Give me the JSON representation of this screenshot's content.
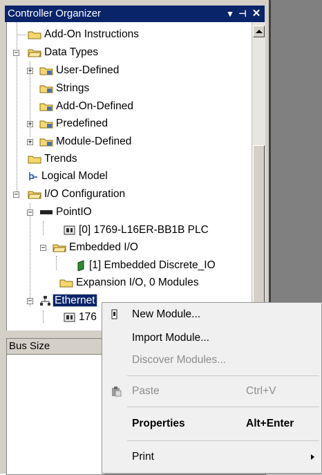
{
  "panel": {
    "title": "Controller Organizer",
    "pin_icon": "pin-icon",
    "close_icon": "close-icon",
    "dropdown_icon": "chevron-down-icon"
  },
  "tree": [
    {
      "label": "Add-On Instructions",
      "icon": "folder-icon"
    },
    {
      "label": "Data Types",
      "icon": "folder-open-icon"
    },
    {
      "label": "User-Defined",
      "icon": "datatype-folder-icon"
    },
    {
      "label": "Strings",
      "icon": "datatype-folder-icon"
    },
    {
      "label": "Add-On-Defined",
      "icon": "datatype-folder-icon"
    },
    {
      "label": "Predefined",
      "icon": "datatype-folder-icon"
    },
    {
      "label": "Module-Defined",
      "icon": "datatype-folder-icon"
    },
    {
      "label": "Trends",
      "icon": "folder-icon"
    },
    {
      "label": "Logical Model",
      "icon": "logical-model-icon"
    },
    {
      "label": "I/O Configuration",
      "icon": "folder-open-icon"
    },
    {
      "label": "PointIO",
      "icon": "backplane-icon"
    },
    {
      "label": "[0] 1769-L16ER-BB1B PLC",
      "icon": "controller-module-icon"
    },
    {
      "label": "Embedded I/O",
      "icon": "folder-open-icon"
    },
    {
      "label": "[1] Embedded Discrete_IO",
      "icon": "io-module-icon"
    },
    {
      "label": "Expansion I/O, 0 Modules",
      "icon": "folder-icon"
    },
    {
      "label": "Ethernet",
      "icon": "network-icon"
    },
    {
      "label": "176",
      "icon": "controller-module-icon"
    }
  ],
  "bottom_panel": {
    "header": "Bus Size"
  },
  "context_menu": {
    "items": [
      {
        "label": "New Module...",
        "shortcut": "",
        "enabled": true,
        "bold": false,
        "icon": "new-module-icon"
      },
      {
        "label": "Import Module...",
        "shortcut": "",
        "enabled": true,
        "bold": false
      },
      {
        "label": "Discover Modules...",
        "shortcut": "",
        "enabled": false,
        "bold": false
      },
      {
        "label": "Paste",
        "shortcut": "Ctrl+V",
        "enabled": false,
        "bold": false,
        "icon": "paste-icon"
      },
      {
        "label": "Properties",
        "shortcut": "Alt+Enter",
        "enabled": true,
        "bold": true
      },
      {
        "label": "Print",
        "shortcut": "",
        "enabled": true,
        "bold": false,
        "submenu": true
      }
    ]
  },
  "colors": {
    "titlebar": "#0a246a",
    "selection": "#0a246a",
    "folder": "#f5d76e"
  }
}
